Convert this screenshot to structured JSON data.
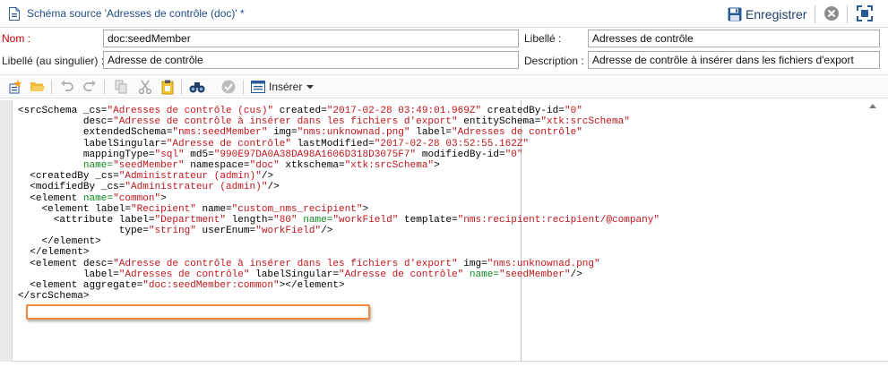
{
  "window": {
    "title": "Schéma source 'Adresses de contrôle (doc)' *",
    "save_label": "Enregistrer"
  },
  "form": {
    "name_label": "Nom :",
    "name_value": "doc:seedMember",
    "libelle_label": "Libellé :",
    "libelle_value": "Adresses de contrôle",
    "singular_label": "Libellé (au singulier) :",
    "singular_value": "Adresse de contrôle",
    "description_label": "Description :",
    "description_value": "Adresse de contrôle à insérer dans les fichiers d'export"
  },
  "toolbar": {
    "insert_label": "Insérer"
  },
  "colors": {
    "title_blue": "#1f4e86",
    "required_red": "#d00000",
    "attr_value": "#c0161b",
    "attr_name_green": "#0c8a1e",
    "highlight_orange": "#f08a3c"
  },
  "icons": [
    "schema-file-icon",
    "save-disk-icon",
    "close-circle-icon",
    "maximize-icon",
    "new-element-icon",
    "open-folder-icon",
    "undo-icon",
    "redo-icon",
    "copy-icon",
    "cut-icon",
    "paste-icon",
    "find-binoculars-icon",
    "validate-icon",
    "insert-icon",
    "dropdown-arrow-icon"
  ],
  "code_lines": [
    [
      [
        "tg",
        "<srcSchema "
      ],
      [
        "an",
        "_cs="
      ],
      [
        "av",
        "\"Adresses de contrôle (cus)\""
      ],
      [
        "an",
        " created="
      ],
      [
        "av",
        "\"2017-02-28 03:49:01.969Z\""
      ],
      [
        "an",
        " createdBy-id="
      ],
      [
        "av",
        "\"0\""
      ]
    ],
    [
      [
        "an",
        "           desc="
      ],
      [
        "av",
        "\"Adresse de contrôle à insérer dans les fichiers d'export\""
      ],
      [
        "an",
        " entitySchema="
      ],
      [
        "av",
        "\"xtk:srcSchema\""
      ]
    ],
    [
      [
        "an",
        "           extendedSchema="
      ],
      [
        "av",
        "\"nms:seedMember\""
      ],
      [
        "an",
        " img="
      ],
      [
        "av",
        "\"nms:unknownad.png\""
      ],
      [
        "an",
        " label="
      ],
      [
        "av",
        "\"Adresses de contrôle\""
      ]
    ],
    [
      [
        "an",
        "           labelSingular="
      ],
      [
        "av",
        "\"Adresse de contrôle\""
      ],
      [
        "an",
        " lastModified="
      ],
      [
        "av",
        "\"2017-02-28 03:52:55.162Z\""
      ]
    ],
    [
      [
        "an",
        "           mappingType="
      ],
      [
        "av",
        "\"sql\""
      ],
      [
        "an",
        " md5="
      ],
      [
        "av",
        "\"990E97DA0A38DA98A1606D318D3075F7\""
      ],
      [
        "an",
        " modifiedBy-id="
      ],
      [
        "av",
        "\"0\""
      ]
    ],
    [
      [
        "ag",
        "           name="
      ],
      [
        "av",
        "\"seedMember\""
      ],
      [
        "an",
        " namespace="
      ],
      [
        "av",
        "\"doc\""
      ],
      [
        "an",
        " xtkschema="
      ],
      [
        "av",
        "\"xtk:srcSchema\""
      ],
      [
        "tg",
        ">"
      ]
    ],
    [
      [
        "tg",
        "  <createdBy "
      ],
      [
        "an",
        "_cs="
      ],
      [
        "av",
        "\"Administrateur (admin)\""
      ],
      [
        "tg",
        "/>"
      ]
    ],
    [
      [
        "tg",
        "  <modifiedBy "
      ],
      [
        "an",
        "_cs="
      ],
      [
        "av",
        "\"Administrateur (admin)\""
      ],
      [
        "tg",
        "/>"
      ]
    ],
    [
      [
        "tg",
        "  <element "
      ],
      [
        "ag",
        "name="
      ],
      [
        "av",
        "\"common\""
      ],
      [
        "tg",
        ">"
      ]
    ],
    [
      [
        "tg",
        "    <element "
      ],
      [
        "an",
        "label="
      ],
      [
        "av",
        "\"Recipient\""
      ],
      [
        "an",
        " name="
      ],
      [
        "av",
        "\"custom_nms_recipient\""
      ],
      [
        "tg",
        ">"
      ]
    ],
    [
      [
        "tg",
        "      <attribute "
      ],
      [
        "an",
        "label="
      ],
      [
        "av",
        "\"Department\""
      ],
      [
        "an",
        " length="
      ],
      [
        "av",
        "\"80\""
      ],
      [
        "ag",
        " name="
      ],
      [
        "av",
        "\"workField\""
      ],
      [
        "an",
        " template="
      ],
      [
        "av",
        "\"nms:recipient:recipient/@company\""
      ]
    ],
    [
      [
        "an",
        "                 type="
      ],
      [
        "av",
        "\"string\""
      ],
      [
        "an",
        " userEnum="
      ],
      [
        "av",
        "\"workField\""
      ],
      [
        "tg",
        "/>"
      ]
    ],
    [
      [
        "tg",
        "    </element>"
      ]
    ],
    [
      [
        "tg",
        "  </element>"
      ]
    ],
    [
      [
        "tg",
        "  <element "
      ],
      [
        "an",
        "desc="
      ],
      [
        "av",
        "\"Adresse de contrôle à insérer dans les fichiers d'export\""
      ],
      [
        "an",
        " img="
      ],
      [
        "av",
        "\"nms:unknownad.png\""
      ]
    ],
    [
      [
        "an",
        "           label="
      ],
      [
        "av",
        "\"Adresses de contrôle\""
      ],
      [
        "an",
        " labelSingular="
      ],
      [
        "av",
        "\"Adresse de contrôle\""
      ],
      [
        "ag",
        " name="
      ],
      [
        "av",
        "\"seedMember\""
      ],
      [
        "tg",
        "/>"
      ]
    ],
    [
      [
        "tg",
        "  <element "
      ],
      [
        "an",
        "aggregate="
      ],
      [
        "av",
        "\"doc:seedMember:common\""
      ],
      [
        "tg",
        "></element>"
      ]
    ],
    [
      [
        "tg",
        "</srcSchema>"
      ]
    ]
  ]
}
